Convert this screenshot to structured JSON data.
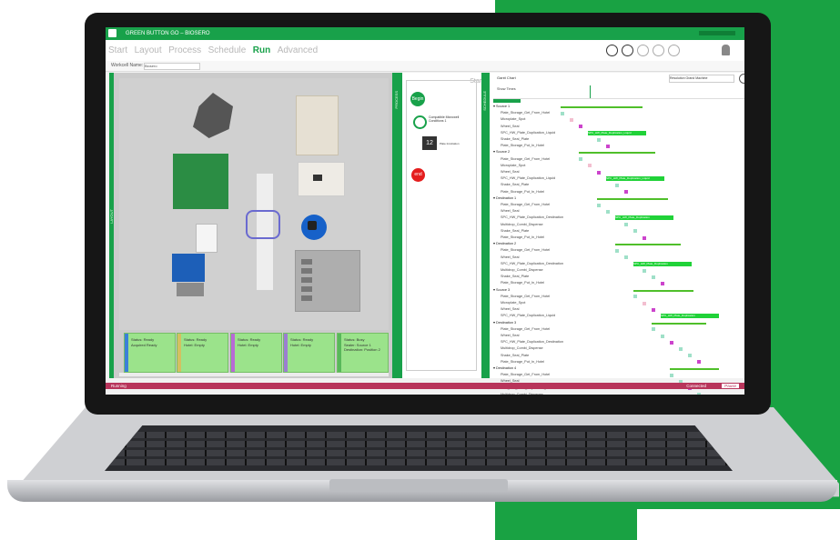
{
  "window": {
    "title": "GREEN BUTTON GO – BIOSERO",
    "menus": [
      "Start",
      "Layout",
      "Process",
      "Schedule",
      "Run",
      "Advanced"
    ],
    "active_menu": "Run",
    "workcell_label": "Workcell Name:",
    "workcell_value": "Biosero"
  },
  "panels": {
    "layout": "LAYOUT",
    "process": "PROCESS",
    "schedule": "SCHEDULE"
  },
  "process": {
    "start_label": "Start",
    "begin": "Begin",
    "step_text": "Compatible Microwell Conditions 1",
    "timer_value": "12",
    "timer_caption": "Plate Incubation",
    "end": "end"
  },
  "schedule": {
    "tab_label": "Gantt Chart",
    "header_label": "Show Times",
    "status_dropdown": "Resolution Grand Machine",
    "groups": [
      {
        "name": "Source 1",
        "steps": [
          "Plate_Storage_Get_From_Hotel",
          "Microplate_Spot",
          "Wheel_Seal",
          "SPC_HW_Plate_Duplication_Liquid",
          "Shake_Seal_Plate",
          "Plate_Storage_Put_In_Hotel"
        ]
      },
      {
        "name": "Source 2",
        "steps": [
          "Plate_Storage_Get_From_Hotel",
          "Microplate_Spot",
          "Wheel_Seal",
          "SPC_HW_Plate_Duplication_Liquid",
          "Shake_Seal_Plate",
          "Plate_Storage_Put_In_Hotel"
        ]
      },
      {
        "name": "Destination 1",
        "steps": [
          "Plate_Storage_Get_From_Hotel",
          "Wheel_Seal",
          "SPC_HW_Plate_Duplication_Destination",
          "Multidrop_Combi_Dispense",
          "Shake_Seal_Plate",
          "Plate_Storage_Put_In_Hotel"
        ]
      },
      {
        "name": "Destination 2",
        "steps": [
          "Plate_Storage_Get_From_Hotel",
          "Wheel_Seal",
          "SPC_HW_Plate_Duplication_Destination",
          "Multidrop_Combi_Dispense",
          "Shake_Seal_Plate",
          "Plate_Storage_Put_In_Hotel"
        ]
      },
      {
        "name": "Source 3",
        "steps": [
          "Plate_Storage_Get_From_Hotel",
          "Microplate_Spot",
          "Wheel_Seal",
          "SPC_HW_Plate_Duplication_Liquid"
        ]
      },
      {
        "name": "Destination 3",
        "steps": [
          "Plate_Storage_Get_From_Hotel",
          "Wheel_Seal",
          "SPC_HW_Plate_Duplication_Destination",
          "Multidrop_Combi_Dispense",
          "Shake_Seal_Plate",
          "Plate_Storage_Put_In_Hotel"
        ]
      },
      {
        "name": "Destination 4",
        "steps": [
          "Plate_Storage_Get_From_Hotel",
          "Wheel_Seal",
          "SPC_HW_Plate_Duplication_Destination",
          "Multidrop_Combi_Dispense"
        ]
      }
    ],
    "block_labels": [
      "SPC_HW_Plate_Duplication_Liquid",
      "SPC_HW_Plate_Duplication_Liquid",
      "SPC_HW_Plate_Duplication",
      "SPC_HW_Plate_Duplication",
      "SPC_HW_Plate_Duplication"
    ]
  },
  "devices": [
    {
      "name": "Liquid Handler",
      "status": "Status: Ready",
      "state": "Acquired Ready",
      "color": "#3a80d8"
    },
    {
      "name": "Plate Storage",
      "status": "Status: Ready",
      "state": "Hotel: Empty",
      "color": "#d4c060"
    },
    {
      "name": "Incubator",
      "status": "Status: Ready",
      "state": "Hotel: Empty",
      "color": "#b86ad6"
    },
    {
      "name": "Dispenser",
      "status": "Status: Ready",
      "state": "Hotel: Empty",
      "color": "#9b7fd1"
    },
    {
      "name": "Sealer",
      "status": "Status: Busy",
      "state": "Sealer: Source 1 Destination: Position 2",
      "color": "#58b85a"
    }
  ],
  "statusbar": {
    "left": "Running",
    "right_label": "Connected",
    "right_badge": "Pause"
  },
  "colors": {
    "brand_green": "#18a14a",
    "status_bar": "#b8355b",
    "gantt_green": "#20d238",
    "gantt_pink": "#f3bfd0"
  }
}
